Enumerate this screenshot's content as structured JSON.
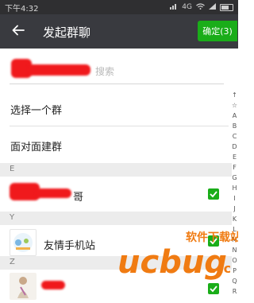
{
  "status_bar": {
    "time": "下午4:32",
    "network": "4G"
  },
  "header": {
    "title": "发起群聊",
    "confirm_label": "确定(3)"
  },
  "search": {
    "placeholder": "搜索"
  },
  "menu": [
    {
      "label": "选择一个群"
    },
    {
      "label": "面对面建群"
    }
  ],
  "sections": [
    {
      "letter": "E",
      "contacts": [
        {
          "name": "哥",
          "checked": true
        }
      ]
    },
    {
      "letter": "Y",
      "contacts": [
        {
          "name": "友情手机站",
          "checked": true
        }
      ]
    },
    {
      "letter": "Z",
      "contacts": [
        {
          "name": "",
          "checked": true
        }
      ]
    }
  ],
  "index_letters": [
    "↑",
    "☆",
    "A",
    "B",
    "C",
    "D",
    "E",
    "F",
    "G",
    "H",
    "I",
    "J",
    "K",
    "L",
    "M",
    "N",
    "O",
    "P",
    "Q",
    "R"
  ],
  "watermark": {
    "brand": "ucbug",
    "suffix": ".cc",
    "cn_text": "软件下载站"
  },
  "colors": {
    "app_bar": "#393a3f",
    "status_bar": "#2f2f31",
    "accent_green": "#1aad19",
    "section_bg": "#ececec",
    "watermark_orange": "#f07b12",
    "redaction_red": "#f0191c"
  }
}
